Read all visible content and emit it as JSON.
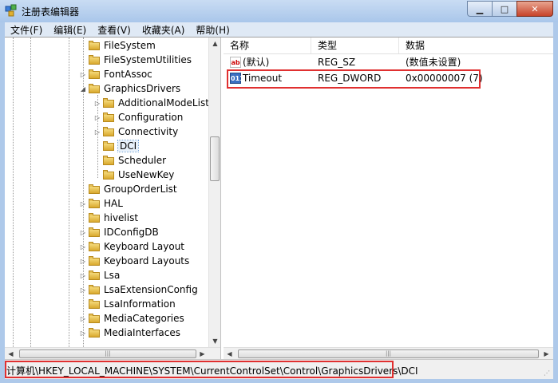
{
  "window": {
    "title": "注册表编辑器",
    "app_icon": "regedit-icon"
  },
  "menu": [
    "文件(F)",
    "编辑(E)",
    "查看(V)",
    "收藏夹(A)",
    "帮助(H)"
  ],
  "tree": {
    "items": [
      {
        "label": "FileSystem",
        "expander": "none",
        "level": 1
      },
      {
        "label": "FileSystemUtilities",
        "expander": "none",
        "level": 1
      },
      {
        "label": "FontAssoc",
        "expander": "collapsed",
        "level": 1
      },
      {
        "label": "GraphicsDrivers",
        "expander": "expanded",
        "level": 1
      },
      {
        "label": "AdditionalModeLists",
        "expander": "collapsed",
        "level": 2
      },
      {
        "label": "Configuration",
        "expander": "collapsed",
        "level": 2
      },
      {
        "label": "Connectivity",
        "expander": "collapsed",
        "level": 2
      },
      {
        "label": "DCI",
        "expander": "none",
        "level": 2,
        "selected": true
      },
      {
        "label": "Scheduler",
        "expander": "none",
        "level": 2
      },
      {
        "label": "UseNewKey",
        "expander": "none",
        "level": 2
      },
      {
        "label": "GroupOrderList",
        "expander": "none",
        "level": 1
      },
      {
        "label": "HAL",
        "expander": "collapsed",
        "level": 1
      },
      {
        "label": "hivelist",
        "expander": "none",
        "level": 1
      },
      {
        "label": "IDConfigDB",
        "expander": "collapsed",
        "level": 1
      },
      {
        "label": "Keyboard Layout",
        "expander": "collapsed",
        "level": 1
      },
      {
        "label": "Keyboard Layouts",
        "expander": "collapsed",
        "level": 1
      },
      {
        "label": "Lsa",
        "expander": "collapsed",
        "level": 1
      },
      {
        "label": "LsaExtensionConfig",
        "expander": "collapsed",
        "level": 1
      },
      {
        "label": "LsaInformation",
        "expander": "none",
        "level": 1
      },
      {
        "label": "MediaCategories",
        "expander": "collapsed",
        "level": 1
      },
      {
        "label": "MediaInterfaces",
        "expander": "collapsed",
        "level": 1
      }
    ]
  },
  "list": {
    "columns": [
      "名称",
      "类型",
      "数据"
    ],
    "rows": [
      {
        "icon": "string-value-icon",
        "icon_text": "ab",
        "name": "(默认)",
        "type": "REG_SZ",
        "data": "(数值未设置)"
      },
      {
        "icon": "dword-value-icon",
        "icon_text": "011",
        "name": "Timeout",
        "type": "REG_DWORD",
        "data": "0x00000007 (7)",
        "highlighted": true
      }
    ]
  },
  "status": {
    "path": "计算机\\HKEY_LOCAL_MACHINE\\SYSTEM\\CurrentControlSet\\Control\\GraphicsDrivers\\DCI",
    "highlighted": true
  },
  "colors": {
    "highlight": "#e03030",
    "titlebar": "#a9c6ea",
    "close": "#c7432a"
  }
}
